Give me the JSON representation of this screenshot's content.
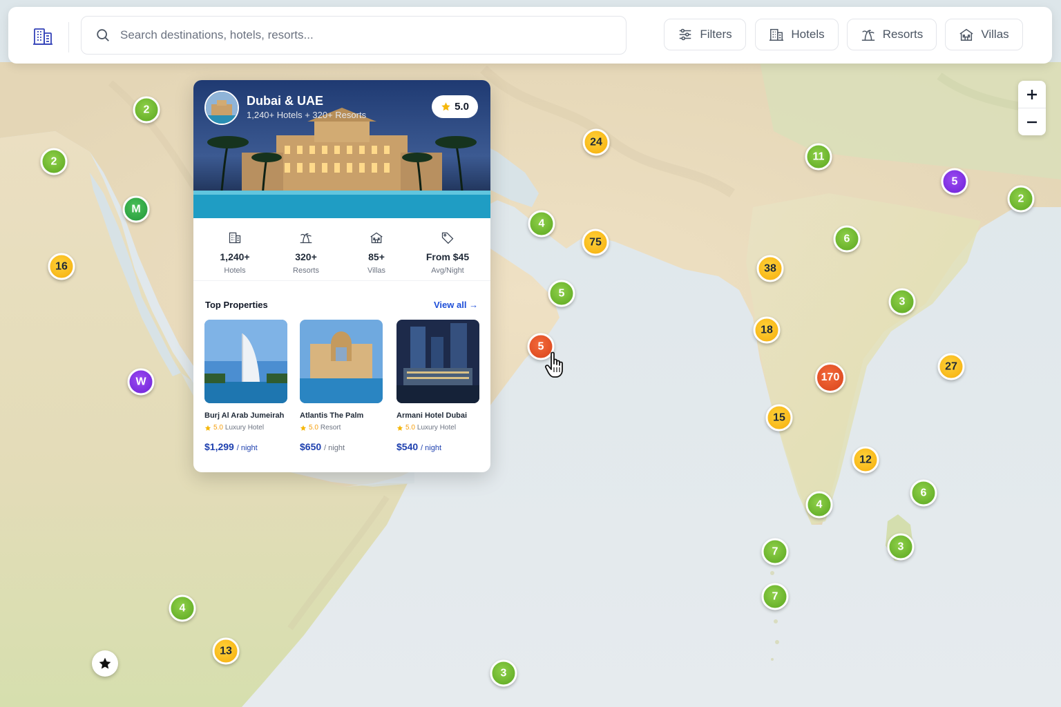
{
  "search": {
    "placeholder": "Search destinations, hotels, resorts..."
  },
  "header_buttons": {
    "filters": "Filters",
    "hotels": "Hotels",
    "resorts": "Resorts",
    "villas": "Villas"
  },
  "icons": {
    "logo": "hotel-building-icon",
    "search": "search-icon",
    "filters": "sliders-icon",
    "hotels": "building-icon",
    "resorts": "palm-tree-icon",
    "villas": "villa-icon",
    "zoom_in": "plus-icon",
    "zoom_out": "minus-icon",
    "favorites": "star-icon",
    "cursor": "hand-pointer-icon"
  },
  "zoom": {
    "in": "+",
    "out": "−"
  },
  "markers": [
    {
      "label": "2",
      "color": "green"
    },
    {
      "label": "2",
      "color": "green"
    },
    {
      "label": "M",
      "color": "darkgreen"
    },
    {
      "label": "16",
      "color": "yellow"
    },
    {
      "label": "W",
      "color": "purple"
    },
    {
      "label": "24",
      "color": "yellow"
    },
    {
      "label": "4",
      "color": "green"
    },
    {
      "label": "75",
      "color": "yellow"
    },
    {
      "label": "5",
      "color": "green"
    },
    {
      "label": "5",
      "color": "orange"
    },
    {
      "label": "11",
      "color": "green"
    },
    {
      "label": "5",
      "color": "purple"
    },
    {
      "label": "2",
      "color": "green"
    },
    {
      "label": "6",
      "color": "green"
    },
    {
      "label": "38",
      "color": "yellow"
    },
    {
      "label": "3",
      "color": "green"
    },
    {
      "label": "18",
      "color": "yellow"
    },
    {
      "label": "170",
      "color": "orange"
    },
    {
      "label": "27",
      "color": "yellow"
    },
    {
      "label": "15",
      "color": "yellow"
    },
    {
      "label": "12",
      "color": "yellow"
    },
    {
      "label": "6",
      "color": "green"
    },
    {
      "label": "4",
      "color": "green"
    },
    {
      "label": "3",
      "color": "green"
    },
    {
      "label": "7",
      "color": "green"
    },
    {
      "label": "7",
      "color": "green"
    },
    {
      "label": "4",
      "color": "green"
    },
    {
      "label": "13",
      "color": "yellow"
    },
    {
      "label": "3",
      "color": "green"
    }
  ],
  "card": {
    "title": "Dubai & UAE",
    "subtitle": "1,240+ Hotels + 320+ Resorts",
    "rating": "5.0",
    "stats": [
      {
        "value": "1,240+",
        "label": "Hotels",
        "icon": "building-icon"
      },
      {
        "value": "320+",
        "label": "Resorts",
        "icon": "palm-tree-icon"
      },
      {
        "value": "85+",
        "label": "Villas",
        "icon": "villa-icon"
      },
      {
        "value": "From $45",
        "label": "Avg/Night",
        "icon": "price-tag-icon"
      }
    ],
    "top_properties_label": "Top Properties",
    "view_all": "View all",
    "properties": [
      {
        "name": "Burj Al Arab Jumeirah",
        "rating": "5.0",
        "type": "Luxury Hotel",
        "price": "$1,299",
        "per": "/ night"
      },
      {
        "name": "Atlantis The Palm",
        "rating": "5.0",
        "type": "Resort",
        "price": "$650",
        "per": "/ night"
      },
      {
        "name": "Armani Hotel Dubai",
        "rating": "5.0",
        "type": "Luxury Hotel",
        "price": "$540",
        "per": "/ night"
      }
    ]
  },
  "colors": {
    "accent": "#1d4ed8",
    "marker_green": "#6cbb2a",
    "marker_yellow": "#fbbf24",
    "marker_orange": "#e4522a",
    "marker_purple": "#7c2ee6",
    "star": "#f5b70b"
  }
}
